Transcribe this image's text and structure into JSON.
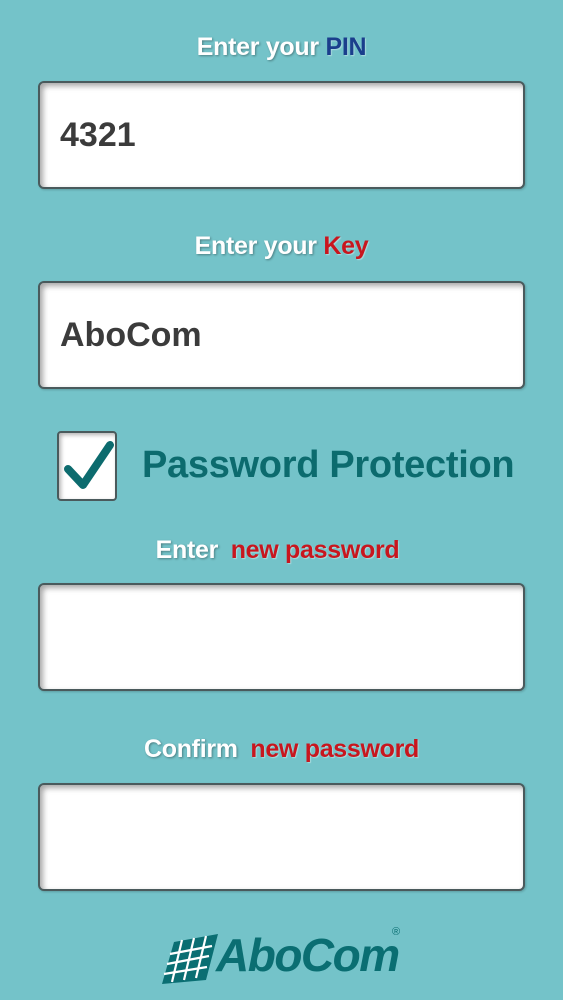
{
  "pin": {
    "label_prefix": "Enter your",
    "label_highlight": "PIN",
    "value": "4321"
  },
  "key": {
    "label_prefix": "Enter your",
    "label_highlight": "Key",
    "value": "AboCom"
  },
  "password_protection": {
    "label": "Password Protection",
    "checked": true
  },
  "new_password": {
    "label_prefix": "Enter",
    "label_highlight": "new password",
    "value": ""
  },
  "confirm_password": {
    "label_prefix": "Confirm",
    "label_highlight": "new password",
    "value": ""
  },
  "logo": {
    "text": "AboCom",
    "registered_mark": "®"
  },
  "colors": {
    "background": "#74c3c9",
    "pin_highlight": "#1a3e8c",
    "red_highlight": "#c8161e",
    "teal_text": "#0c6b6e"
  }
}
